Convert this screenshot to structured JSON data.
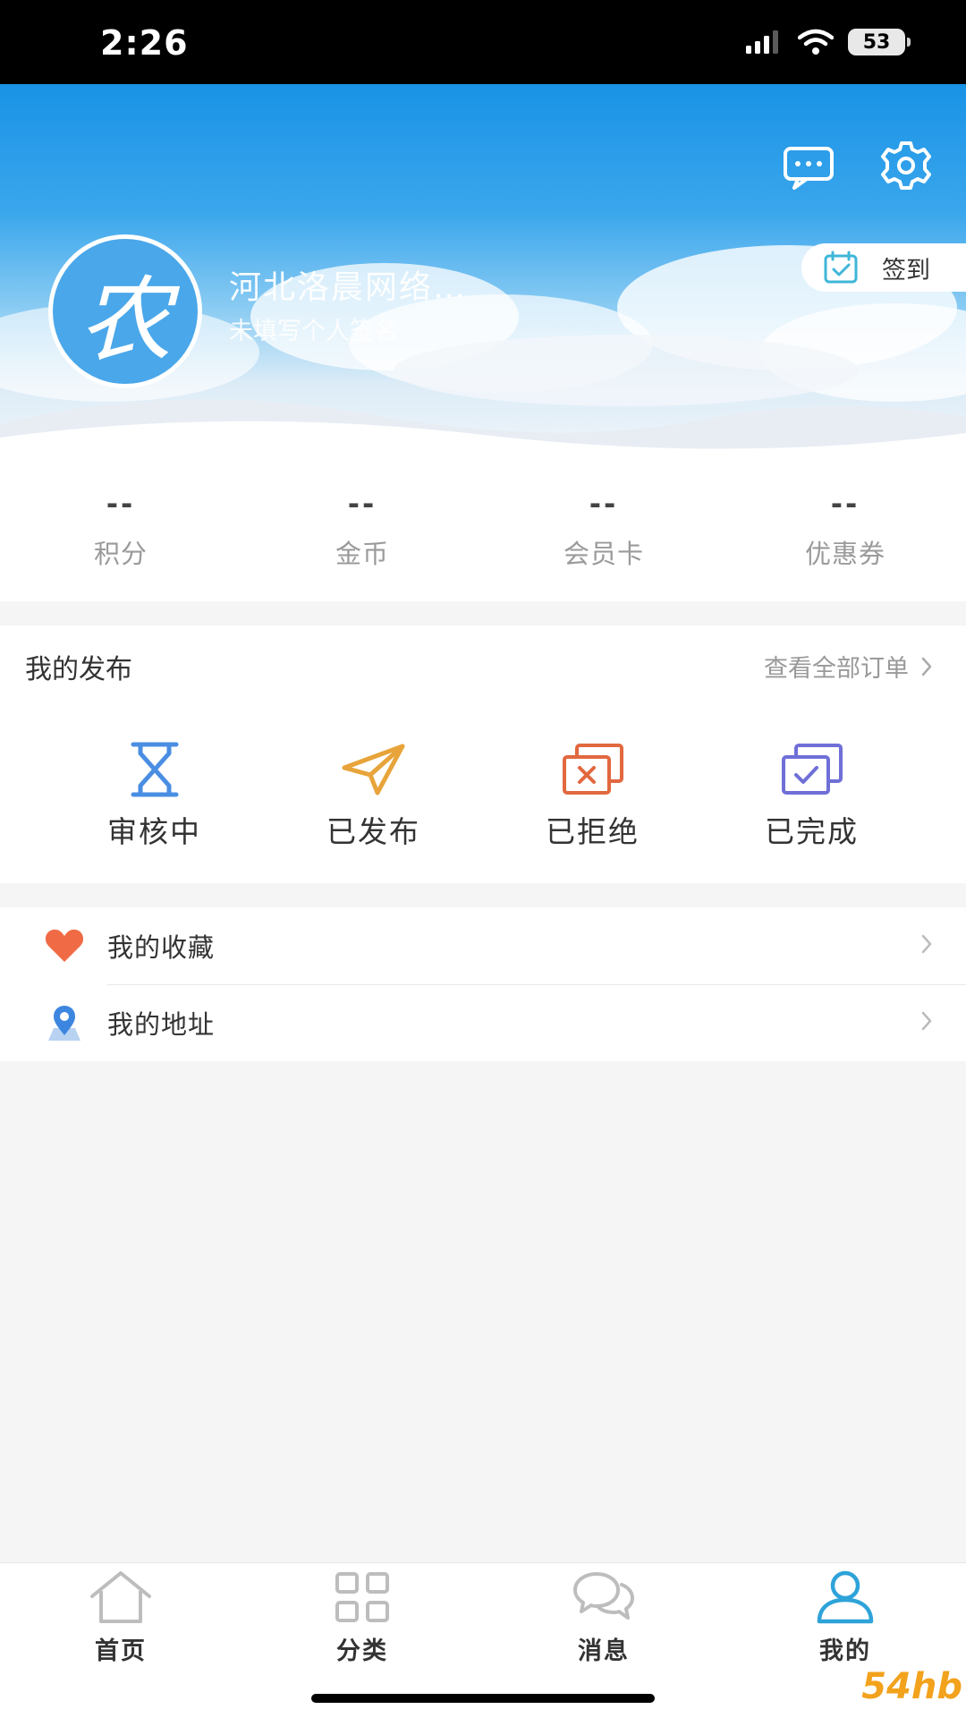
{
  "status_bar": {
    "time": "2:26",
    "battery": "53"
  },
  "header": {
    "user_name": "河北洛晨网络…",
    "user_sign": "未填写个人签名",
    "avatar_char": "农",
    "checkin_label": "签到",
    "icons": [
      "chat-bubble-icon",
      "gear-icon"
    ]
  },
  "stats": [
    {
      "value": "--",
      "label": "积分"
    },
    {
      "value": "--",
      "label": "金币"
    },
    {
      "value": "--",
      "label": "会员卡"
    },
    {
      "value": "--",
      "label": "优惠券"
    }
  ],
  "publish": {
    "title": "我的发布",
    "view_all": "查看全部订单",
    "items": [
      {
        "label": "审核中",
        "icon": "hourglass-icon"
      },
      {
        "label": "已发布",
        "icon": "paper-plane-icon"
      },
      {
        "label": "已拒绝",
        "icon": "rejected-icon"
      },
      {
        "label": "已完成",
        "icon": "completed-icon"
      }
    ]
  },
  "menu": [
    {
      "label": "我的收藏",
      "icon": "heart-icon"
    },
    {
      "label": "我的地址",
      "icon": "location-pin-icon"
    }
  ],
  "tabbar": [
    {
      "label": "首页",
      "icon": "home-icon"
    },
    {
      "label": "分类",
      "icon": "grid-icon"
    },
    {
      "label": "消息",
      "icon": "message-icon"
    },
    {
      "label": "我的",
      "icon": "user-icon",
      "active": true
    }
  ],
  "colors": {
    "accent": "#3aa6ec",
    "blue_icon": "#4a8ee3",
    "orange_icon": "#e8a43a",
    "red_icon": "#e2683f",
    "purple_icon": "#6f6fd8"
  },
  "watermark": "54hb"
}
